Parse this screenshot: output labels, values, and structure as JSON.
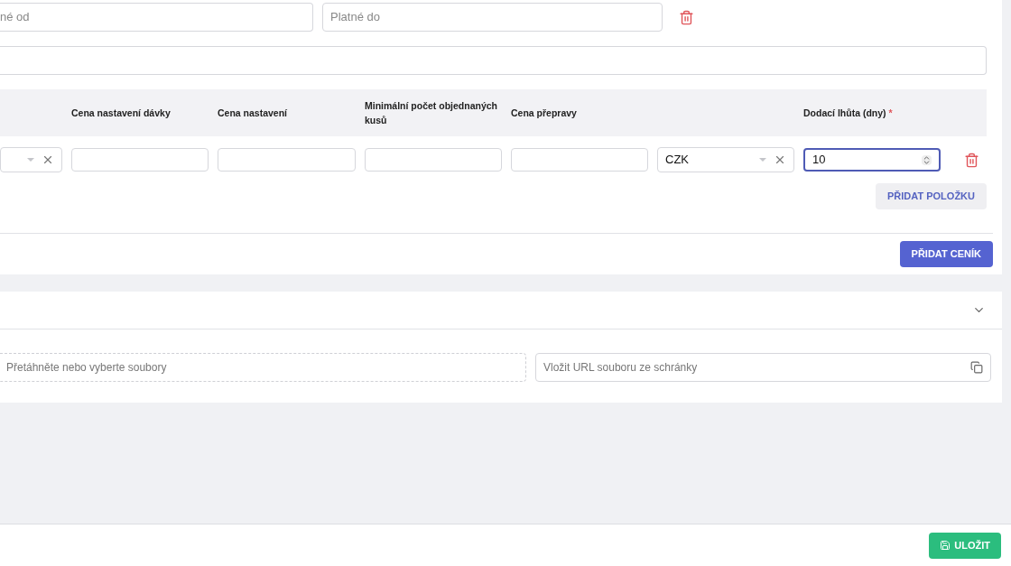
{
  "validity": {
    "from_placeholder": "né od",
    "to_placeholder": "Platné do"
  },
  "items_table": {
    "columns": [
      null,
      "Cena nastavení dávky",
      "Cena nastavení",
      "Minimální počet objednaných kusů",
      "Cena přepravy",
      null,
      {
        "label": "Dodací lhůta (dny)",
        "required_mark": "*"
      }
    ],
    "row": {
      "cells": [
        {
          "kind": "select"
        },
        {
          "kind": "text"
        },
        {
          "kind": "text"
        },
        {
          "kind": "text"
        },
        {
          "kind": "text"
        },
        {
          "kind": "select",
          "value": "CZK"
        },
        {
          "kind": "number",
          "value": "10",
          "focused": true
        }
      ]
    },
    "add_item_button": "PŘIDAT POLOŽKU"
  },
  "add_pricelist_button": "PŘIDAT CENÍK",
  "attachments": {
    "expanded": true,
    "dropzone_placeholder": "Přetáhněte nebo vyberte soubory",
    "url_placeholder": "Vložit URL souboru ze schránky"
  },
  "footer": {
    "save_button": "ULOŽIT"
  }
}
